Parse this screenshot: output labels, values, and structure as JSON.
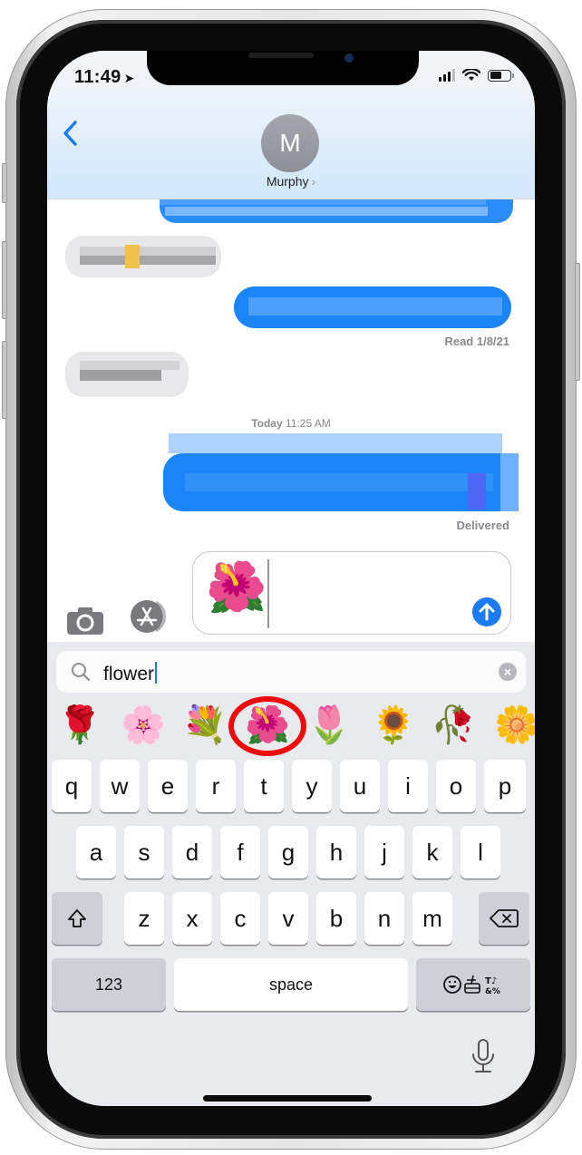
{
  "status_bar": {
    "time": "11:49",
    "location_icon": "location-arrow-icon",
    "signal_bars": 3,
    "signal_max": 4,
    "wifi_icon": "wifi-icon",
    "battery_level": 0.6
  },
  "header": {
    "back_icon": "chevron-left-icon",
    "back_glyph": "‹",
    "avatar_initial": "M",
    "contact_name": "Murphy",
    "contact_chevron": "›"
  },
  "messages": [
    {
      "direction": "sent",
      "content": "[pixelated]"
    },
    {
      "direction": "received",
      "content": "[pixelated]"
    },
    {
      "direction": "sent",
      "content": "[pixelated]",
      "receipt": "Read 1/8/21"
    },
    {
      "direction": "received",
      "content": "[pixelated]"
    },
    {
      "direction": "sent",
      "content": "[pixelated]",
      "timestamp_above": "Today 11:25 AM",
      "receipt": "Delivered"
    }
  ],
  "receipts": {
    "read": "Read 1/8/21",
    "delivered": "Delivered"
  },
  "timestamp": {
    "day": "Today",
    "time": "11:25 AM"
  },
  "composer": {
    "camera_icon": "camera-icon",
    "apps_icon": "app-store-icon",
    "input_value": "🌺",
    "send_icon": "arrow-up-icon"
  },
  "emoji_search": {
    "query": "flower",
    "search_icon": "magnifier-icon",
    "clear_icon": "clear-x-icon",
    "clear_glyph": "×",
    "results": [
      {
        "emoji": "🌹",
        "name": "rose"
      },
      {
        "emoji": "🌸",
        "name": "cherry-blossom"
      },
      {
        "emoji": "💐",
        "name": "bouquet"
      },
      {
        "emoji": "🌺",
        "name": "hibiscus",
        "highlighted": true
      },
      {
        "emoji": "🌷",
        "name": "tulip"
      },
      {
        "emoji": "🌻",
        "name": "sunflower"
      },
      {
        "emoji": "🥀",
        "name": "wilted-flower"
      },
      {
        "emoji": "🌼",
        "name": "blossom"
      }
    ],
    "highlight_color": "#ee0a0a"
  },
  "keyboard": {
    "row1": [
      "q",
      "w",
      "e",
      "r",
      "t",
      "y",
      "u",
      "i",
      "o",
      "p"
    ],
    "row2": [
      "a",
      "s",
      "d",
      "f",
      "g",
      "h",
      "j",
      "k",
      "l"
    ],
    "row3": [
      "z",
      "x",
      "c",
      "v",
      "b",
      "n",
      "m"
    ],
    "shift_glyph": "⇧",
    "delete_glyph": "⌫",
    "numbers_label": "123",
    "space_label": "space",
    "emoji_switch_label": "☺ 🍔 ♪&%",
    "mic_icon": "microphone-icon"
  },
  "colors": {
    "accent": "#1a7cf0",
    "sent_bubble": "#1b85f7",
    "received_bubble": "#e9e9eb",
    "keyboard_bg": "#e9eaee"
  }
}
